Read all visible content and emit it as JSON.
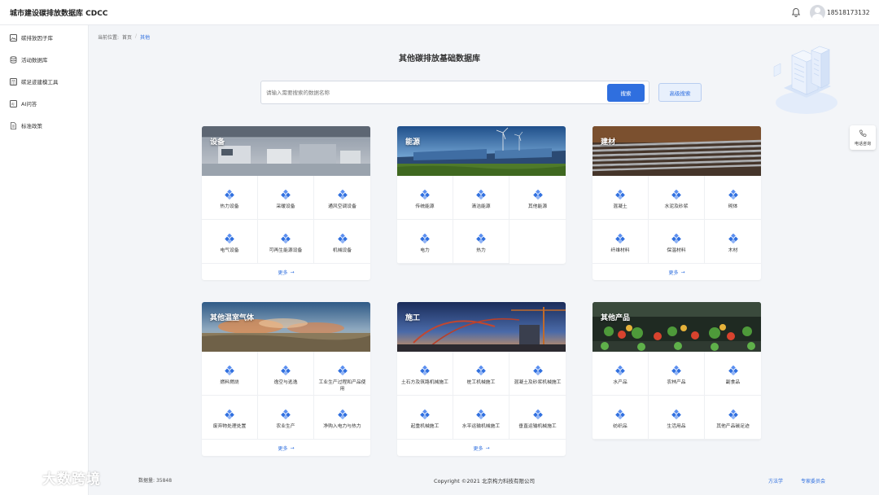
{
  "header": {
    "app_title": "城市建设碳排放数据库 CDCC",
    "user_phone": "18518173132"
  },
  "sidebar": {
    "items": [
      {
        "label": "碳排放因子库",
        "icon": "image-icon"
      },
      {
        "label": "活动数据库",
        "icon": "database-icon"
      },
      {
        "label": "碳足迹建模工具",
        "icon": "calculator-icon"
      },
      {
        "label": "AI问答",
        "icon": "ai-icon"
      },
      {
        "label": "标准政策",
        "icon": "document-icon"
      }
    ]
  },
  "breadcrumb": {
    "prefix": "当前位置:",
    "home": "首页",
    "separator": "/",
    "current": "其他"
  },
  "page": {
    "title": "其他碳排放基础数据库"
  },
  "search": {
    "placeholder": "请输入需要搜索的数据名称",
    "button": "搜索",
    "advanced": "高级搜索"
  },
  "float_phone": {
    "label": "电话咨询"
  },
  "cards": [
    {
      "title": "设备",
      "more": "更多",
      "items": [
        "热力设备",
        "采暖设备",
        "通风空调设备",
        "电气设备",
        "可再生能源设备",
        "机械设备"
      ]
    },
    {
      "title": "能源",
      "more": "",
      "items": [
        "传统能源",
        "清洁能源",
        "其他能源",
        "电力",
        "热力"
      ]
    },
    {
      "title": "建材",
      "more": "更多",
      "items": [
        "混凝土",
        "水泥及砂浆",
        "砌体",
        "纤维材料",
        "保温材料",
        "木材"
      ]
    },
    {
      "title": "其他温室气体",
      "more": "更多",
      "items": [
        "燃料燃烧",
        "逸空与逃逸",
        "工业生产过程和产品使用",
        "废弃物处理处置",
        "农业生产",
        "净购入电力与热力"
      ]
    },
    {
      "title": "施工",
      "more": "更多",
      "items": [
        "土石方及筑路机械施工",
        "桩工机械施工",
        "混凝土及砂浆机械施工",
        "起重机械施工",
        "水平运输机械施工",
        "垂直运输机械施工"
      ]
    },
    {
      "title": "其他产品",
      "more": "",
      "items": [
        "水产品",
        "农林产品",
        "副食品",
        "纺织品",
        "生活用品",
        "其他产品碳足迹"
      ]
    }
  ],
  "footer": {
    "count_label": "数据量:",
    "count": "35848",
    "copyright": "Copyright ©2021 北京构力科技有限公司",
    "links": [
      "方法学",
      "专家委员会"
    ]
  },
  "watermark": "大数跨境",
  "colors": {
    "accent": "#2f6fdf",
    "background": "#f3f5f8"
  }
}
